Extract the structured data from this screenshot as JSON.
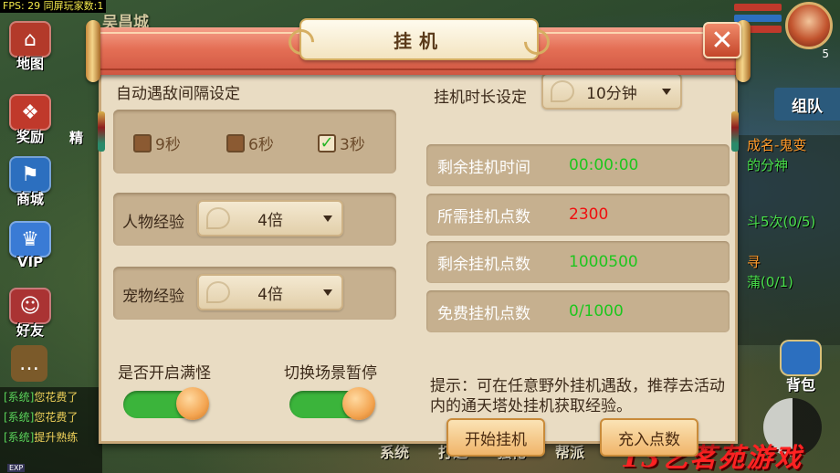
{
  "hud": {
    "fps_text": "FPS: 29 同屏玩家数:1",
    "city_name": "吴昌城",
    "left_icons": [
      {
        "label": "地图",
        "icon": "map-icon",
        "color": "#b33a2a"
      },
      {
        "label": "奖励",
        "icon": "gift-icon",
        "color": "#c0392b"
      },
      {
        "label": "商城",
        "icon": "shop-icon",
        "color": "#2c6fbf"
      },
      {
        "label": "VIP",
        "icon": "vip-crown-icon",
        "color": "#3a7bd5"
      },
      {
        "label": "好友",
        "icon": "friend-avatar-icon",
        "color": "#a33"
      }
    ],
    "partial_left_label": "精",
    "team_label": "组队",
    "quest_lines": [
      {
        "text": "成名-鬼变",
        "color": "orange"
      },
      {
        "text": "的分神",
        "color": "green"
      },
      {
        "text": "斗5次(0/5)",
        "color": "green"
      },
      {
        "text": "寻",
        "color": "orange"
      },
      {
        "text": "蒲(0/1)",
        "color": "green"
      }
    ],
    "level_badge": "5",
    "bag_label": "背包",
    "chat_lines": [
      {
        "tag": "[系统]",
        "who": "您花费了"
      },
      {
        "tag": "[系统]",
        "who": "您花费了"
      },
      {
        "tag": "[系统]",
        "who": "提升熟练"
      }
    ],
    "exp_label": "EXP",
    "bottom_menu": [
      "系统",
      "打造",
      "强化",
      "帮派"
    ],
    "watermark": "13艺茗苑游戏"
  },
  "dialog": {
    "title": "挂机",
    "close_symbol": "✕",
    "encounter_section_label": "自动遇敌间隔设定",
    "interval_options": [
      {
        "label": "9秒",
        "checked": false
      },
      {
        "label": "6秒",
        "checked": false
      },
      {
        "label": "3秒",
        "checked": true
      }
    ],
    "char_exp_label": "人物经验",
    "char_exp_value": "4倍",
    "pet_exp_label": "宠物经验",
    "pet_exp_value": "4倍",
    "duration_label": "挂机时长设定",
    "duration_value": "10分钟",
    "info_rows": [
      {
        "key": "剩余挂机时间",
        "value": "00:00:00",
        "color": "green"
      },
      {
        "key": "所需挂机点数",
        "value": "2300",
        "color": "red"
      },
      {
        "key": "剩余挂机点数",
        "value": "1000500",
        "color": "green"
      },
      {
        "key": "免费挂机点数",
        "value": "0/1000",
        "color": "green"
      }
    ],
    "hint": "提示：可在任意野外挂机遇敌，推荐去活动内的通天塔处挂机获取经验。",
    "full_monster_label": "是否开启满怪",
    "full_monster_on": true,
    "pause_on_switch_label": "切换场景暂停",
    "pause_on_switch_on": true,
    "start_button": "开始挂机",
    "recharge_button": "充入点数",
    "check_mark": "✓"
  }
}
